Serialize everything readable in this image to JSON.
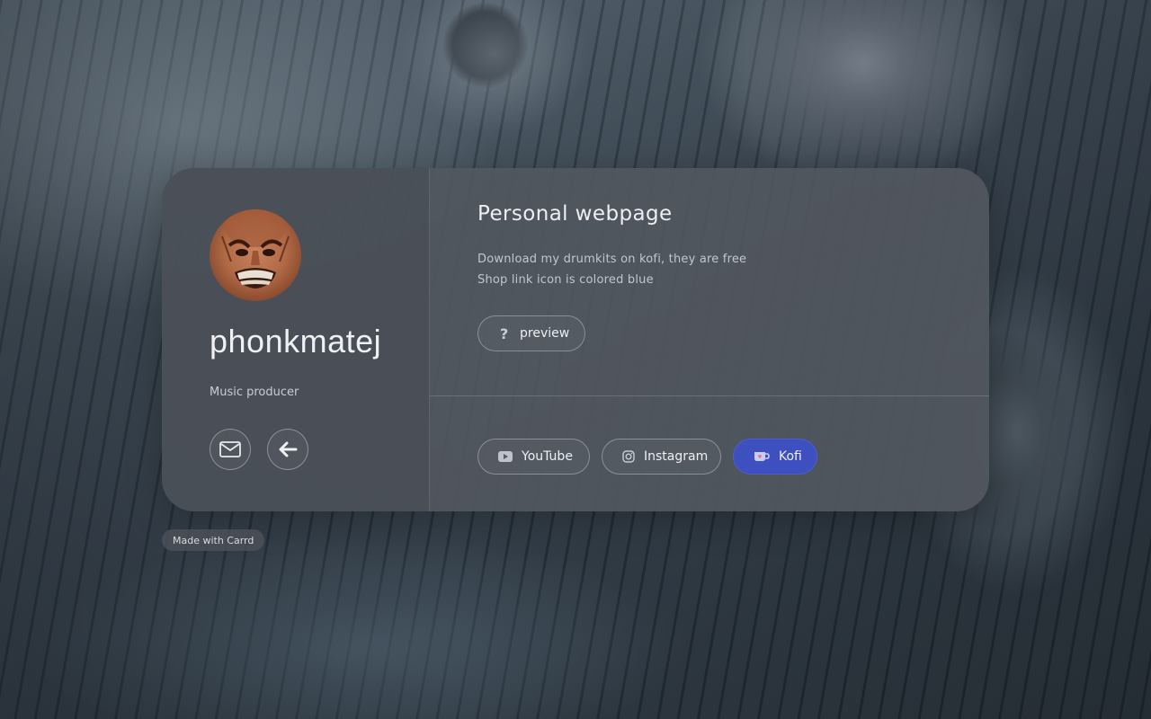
{
  "profile": {
    "name": "phonkmatej",
    "role": "Music producer"
  },
  "contact_buttons": [
    {
      "icon": "mail-icon"
    },
    {
      "icon": "arrow-left-icon"
    }
  ],
  "main": {
    "heading": "Personal webpage",
    "description_lines": [
      "Download my drumkits on kofi, they are free",
      "Shop link icon is colored blue"
    ],
    "preview_button": {
      "label": "preview",
      "icon": "question-icon"
    }
  },
  "links": [
    {
      "label": "YouTube",
      "icon": "youtube-icon"
    },
    {
      "label": "Instagram",
      "icon": "instagram-icon"
    },
    {
      "label": "Kofi",
      "icon": "kofi-cup-icon",
      "color": "#3e4fc0"
    }
  ],
  "footer": {
    "badge": "Made with Carrd"
  }
}
